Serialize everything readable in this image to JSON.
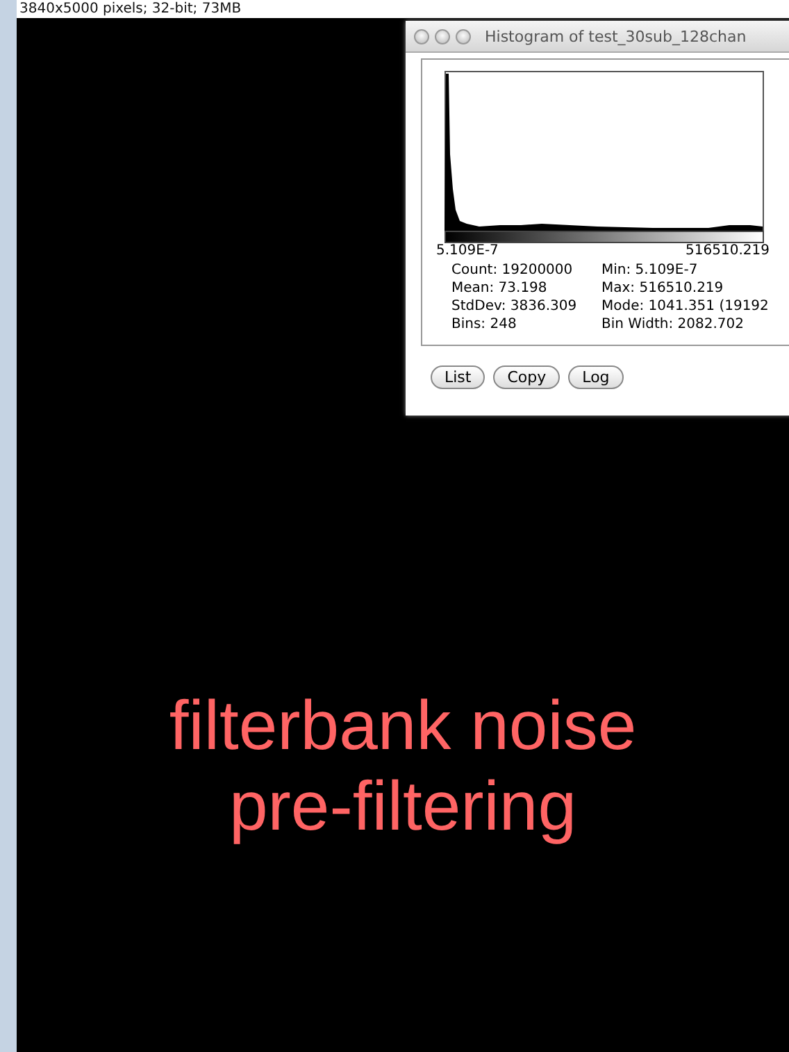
{
  "image_window": {
    "info": "3840x5000 pixels; 32-bit; 73MB"
  },
  "histogram_window": {
    "title": "Histogram of test_30sub_128chan",
    "axis_min": "5.109E-7",
    "axis_max": "516510.219",
    "stats_left": [
      "Count: 19200000",
      "Mean: 73.198",
      "StdDev: 3836.309",
      "Bins: 248"
    ],
    "stats_right": [
      "Min: 5.109E-7",
      "Max: 516510.219",
      "Mode: 1041.351 (19192",
      "Bin Width: 2082.702"
    ],
    "buttons": [
      "List",
      "Copy",
      "Log"
    ]
  },
  "annotation": [
    "filterbank noise",
    "pre-filtering"
  ]
}
